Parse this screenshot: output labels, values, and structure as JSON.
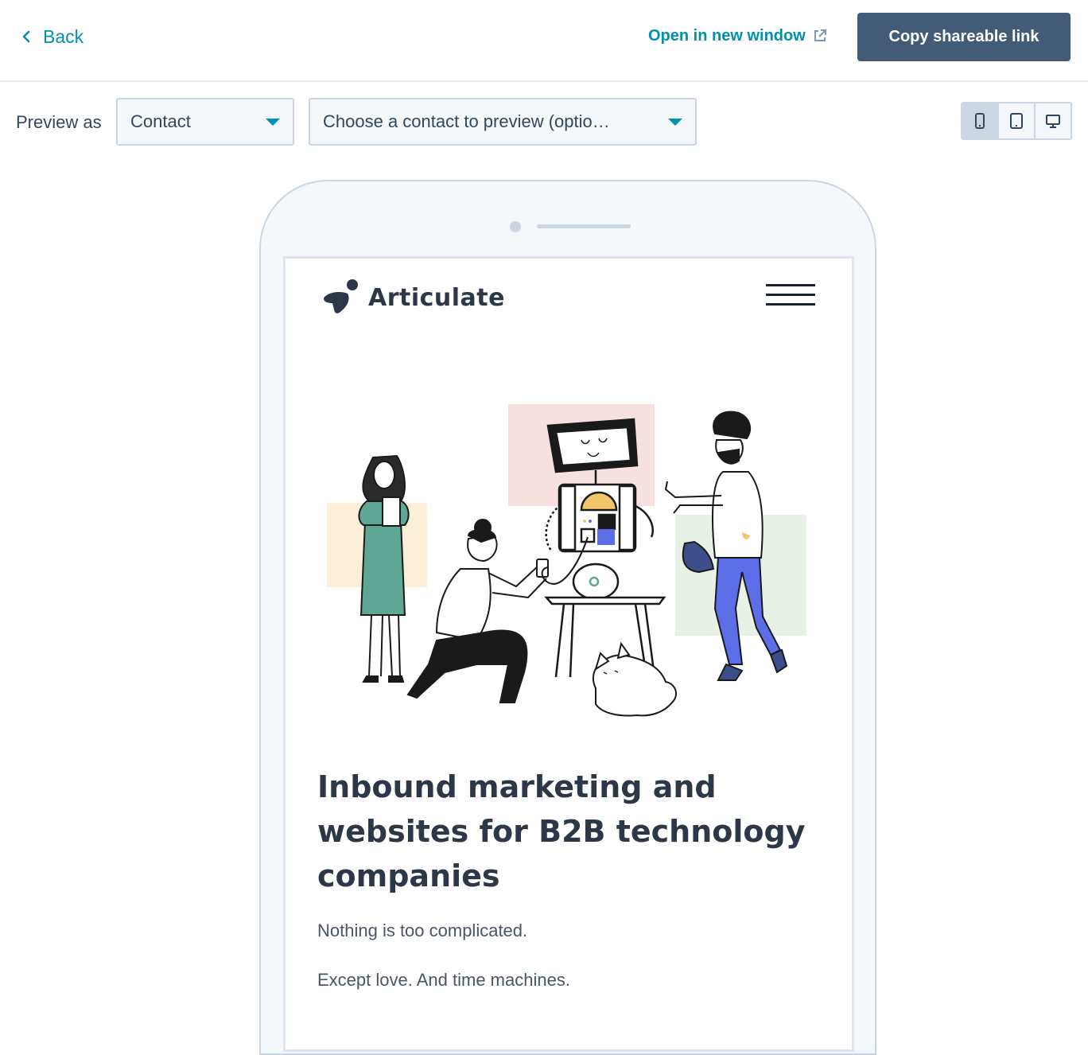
{
  "topbar": {
    "back_label": "Back",
    "open_new_label": "Open in new window",
    "copy_link_label": "Copy shareable link"
  },
  "preview": {
    "label": "Preview as",
    "type_select_value": "Contact",
    "contact_select_value": "Choose a contact to preview (optio…",
    "devices": [
      "mobile",
      "tablet",
      "desktop"
    ],
    "active_device": "mobile"
  },
  "site": {
    "brand": "Articulate",
    "headline": "Inbound marketing and websites for B2B technology companies",
    "paragraphs": [
      "Nothing is too complicated.",
      "Except love. And time machines."
    ]
  },
  "colors": {
    "accent": "#0091ae",
    "primary_button": "#425b76",
    "border": "#cbd6e2",
    "text_dark": "#2d3748"
  },
  "icons": {
    "back": "chevron-left-icon",
    "external": "external-link-icon",
    "caret": "caret-down-icon",
    "hamburger": "hamburger-menu-icon"
  }
}
